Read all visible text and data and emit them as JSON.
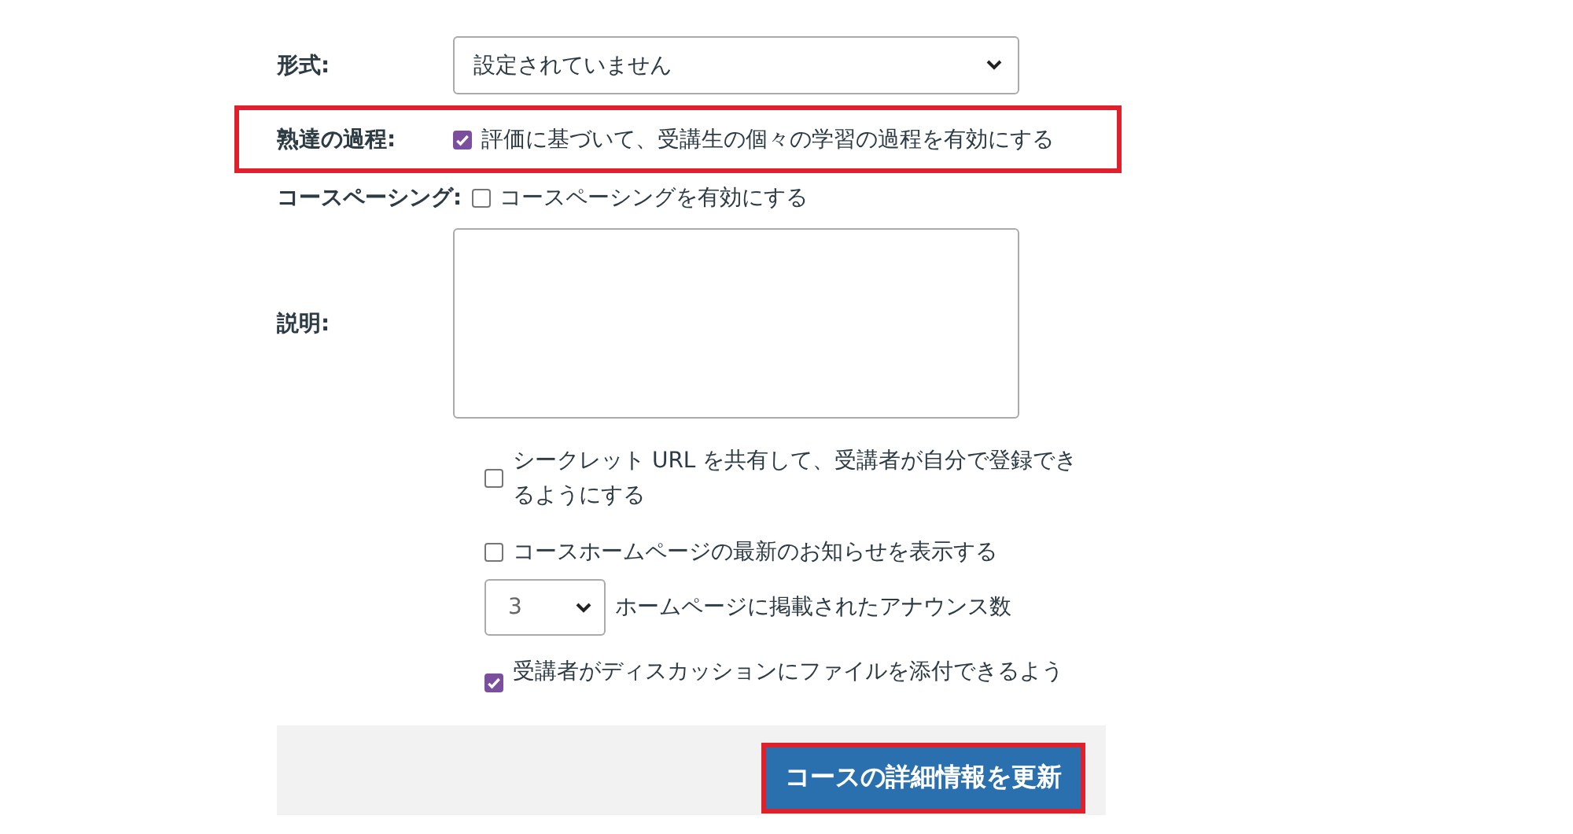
{
  "fields": [
    {
      "kind": "select",
      "label": "形式:",
      "value": "設定されていません",
      "highlighted": false
    },
    {
      "kind": "checkbox",
      "label": "熟達の過程:",
      "text": "評価に基づいて、受講生の個々の学習の過程を有効にする",
      "checked": true,
      "highlighted": true
    },
    {
      "kind": "checkbox",
      "label": "コースペーシング:",
      "text": "コースペーシングを有効にする",
      "checked": false,
      "highlighted": false
    },
    {
      "kind": "textarea",
      "label": "説明:",
      "highlighted": false
    }
  ],
  "options": [
    {
      "kind": "checkbox",
      "text": "シークレット URL を共有して、受講者が自分で登録できるようにする",
      "checked": false
    },
    {
      "kind": "checkbox",
      "text": "コースホームページの最新のお知らせを表示する",
      "checked": false
    },
    {
      "kind": "select",
      "value": "3",
      "text": "ホームページに掲載されたアナウンス数"
    },
    {
      "kind": "checkbox",
      "text": "受講者がディスカッションにファイルを添付できるよう",
      "checked": true
    }
  ],
  "footer": {
    "button": {
      "label": "コースの詳細情報を更新",
      "highlighted": true
    }
  }
}
